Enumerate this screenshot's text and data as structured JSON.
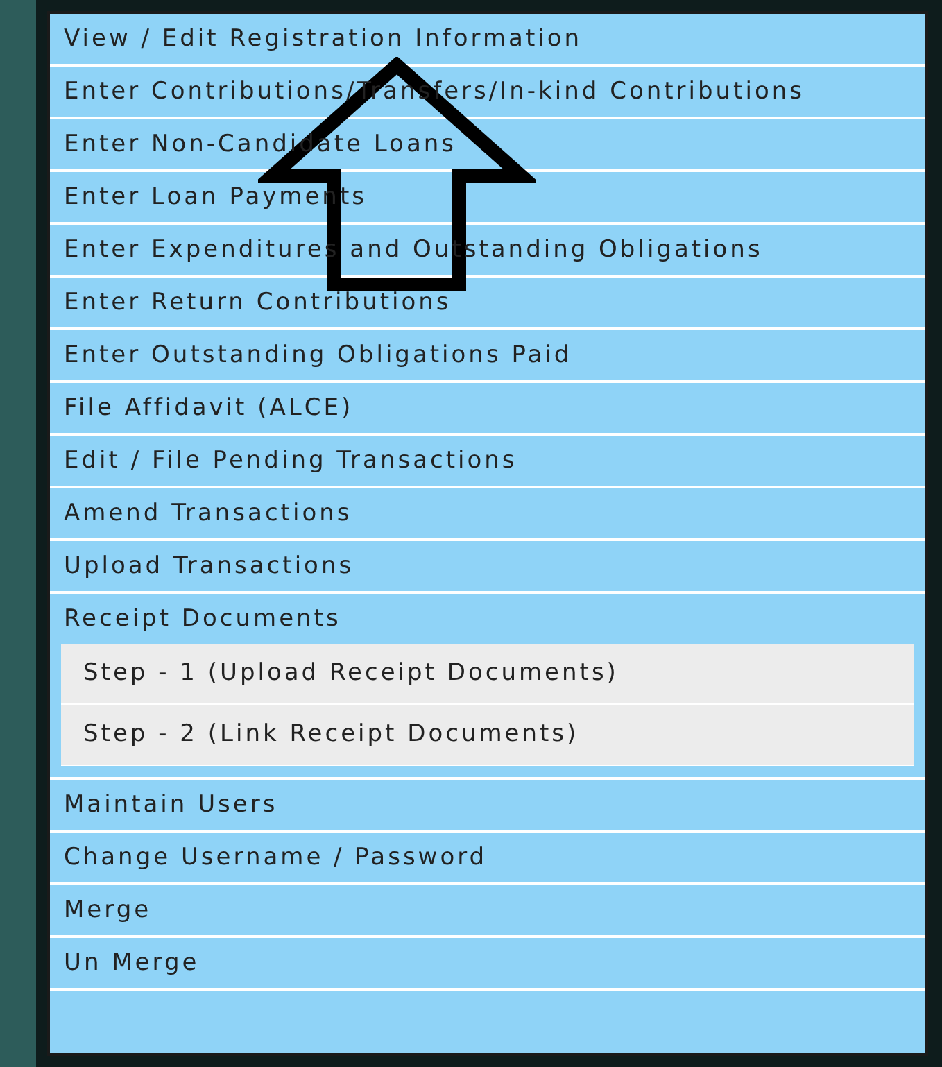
{
  "menu": {
    "items": [
      {
        "label": "View / Edit Registration Information"
      },
      {
        "label": "Enter Contributions/Transfers/In-kind Contributions"
      },
      {
        "label": "Enter Non-Candidate Loans"
      },
      {
        "label": "Enter Loan Payments"
      },
      {
        "label": "Enter Expenditures and Outstanding Obligations"
      },
      {
        "label": "Enter Return Contributions"
      },
      {
        "label": "Enter Outstanding Obligations Paid"
      },
      {
        "label": "File Affidavit (ALCE)"
      },
      {
        "label": "Edit / File Pending Transactions"
      },
      {
        "label": "Amend Transactions"
      },
      {
        "label": "Upload Transactions"
      },
      {
        "label": "Receipt Documents",
        "children": [
          {
            "label": "Step - 1 (Upload Receipt Documents)"
          },
          {
            "label": "Step - 2 (Link Receipt Documents)"
          }
        ]
      },
      {
        "label": "Maintain Users"
      },
      {
        "label": "Change Username / Password"
      },
      {
        "label": "Merge"
      },
      {
        "label": "Un Merge"
      }
    ]
  }
}
